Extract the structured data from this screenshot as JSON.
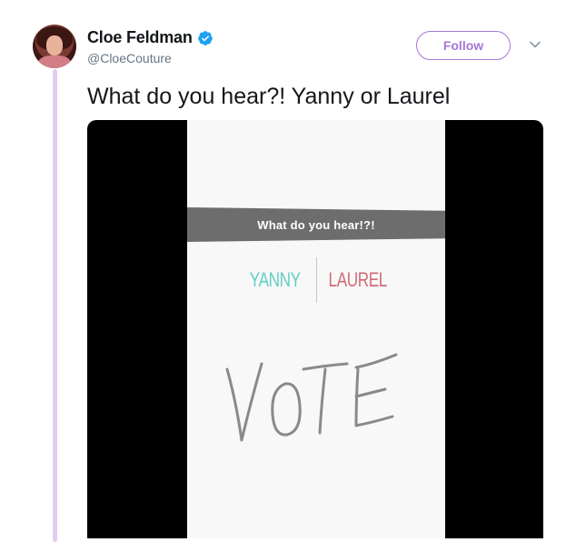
{
  "tweet": {
    "author": {
      "display_name": "Cloe Feldman",
      "handle": "@CloeCouture",
      "verified_icon": "verified-badge-icon"
    },
    "follow_label": "Follow",
    "menu_icon": "chevron-down-icon",
    "text": "What do you hear?! Yanny or Laurel",
    "media": {
      "question": "What do you hear!?!",
      "poll_options": [
        "YANNY",
        "LAUREL"
      ],
      "handwritten": "VOTE"
    }
  },
  "colors": {
    "accent": "#a876d6",
    "thread_line": "#e1cdf1",
    "verified": "#1da1f2",
    "yanny": "#5fcfc4",
    "laurel": "#d16b77"
  }
}
